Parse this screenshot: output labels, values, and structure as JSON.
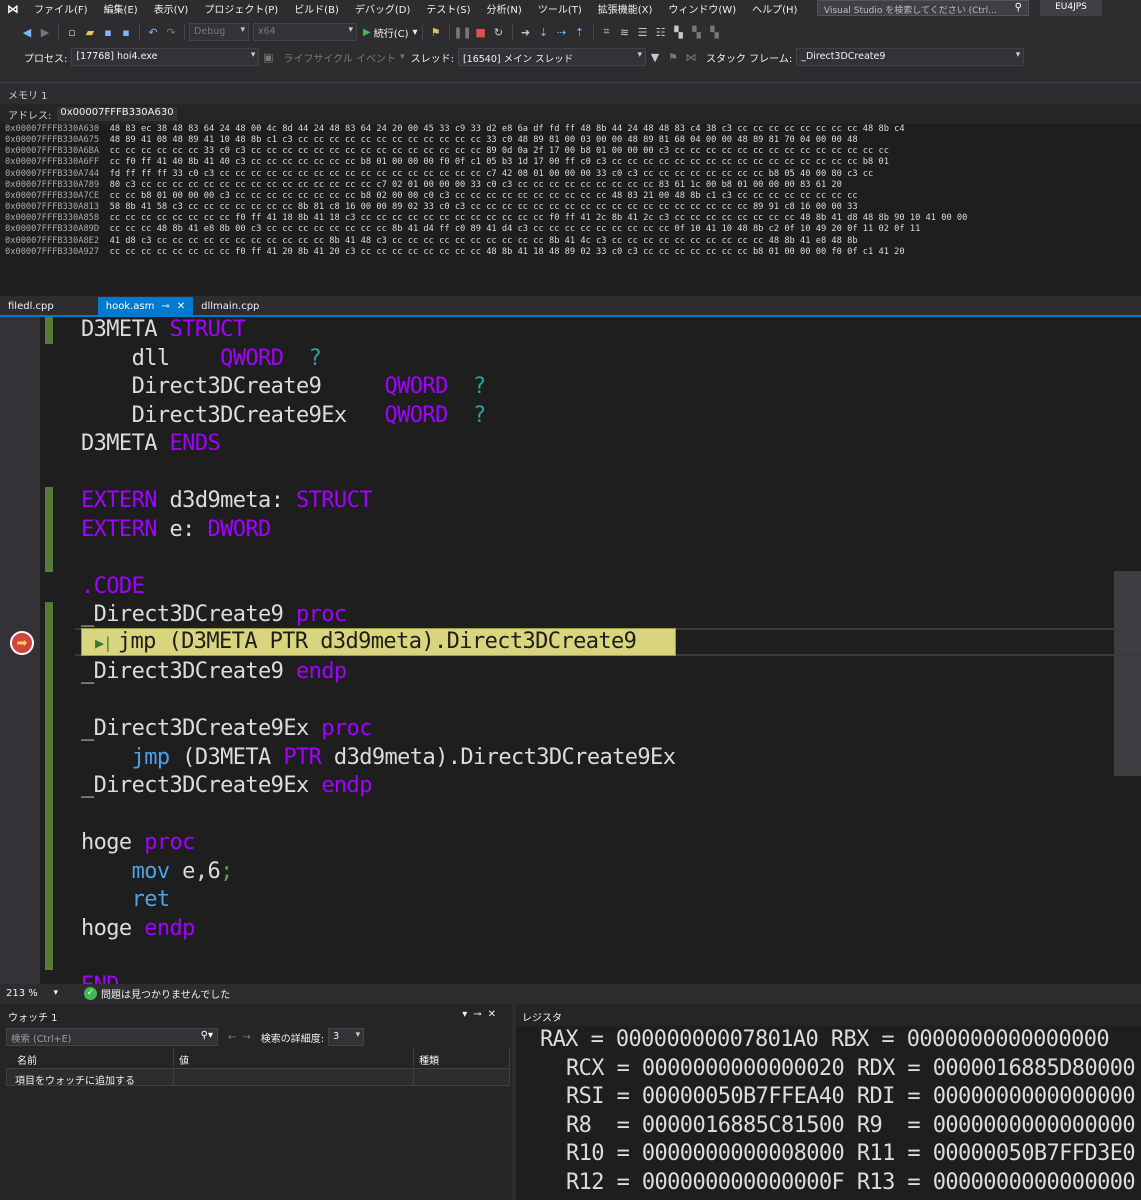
{
  "menu": {
    "items": [
      "ファイル(F)",
      "編集(E)",
      "表示(V)",
      "プロジェクト(P)",
      "ビルド(B)",
      "デバッグ(D)",
      "テスト(S)",
      "分析(N)",
      "ツール(T)",
      "拡張機能(X)",
      "ウィンドウ(W)",
      "ヘルプ(H)"
    ],
    "search_placeholder": "Visual Studio を検索してください (Ctrl...",
    "project_name": "EU4JPS"
  },
  "toolbar": {
    "config": "Debug",
    "platform": "x64",
    "continue_label": "続行(C)",
    "process_label": "プロセス:",
    "process_value": "[17768] hoi4.exe",
    "lifecycle_label": "ライフサイクル イベント",
    "thread_label": "スレッド:",
    "thread_value": "[16540] メイン スレッド",
    "stack_frame_label": "スタック フレーム:",
    "stack_frame_value": "_Direct3DCreate9"
  },
  "memory": {
    "title": "メモリ 1",
    "address_label": "アドレス:",
    "address_value": "0x00007FFFB330A630",
    "rows": [
      {
        "addr": "0x00007FFFB330A630",
        "bytes": "48 83 ec 38 48 83 64 24 48 00 4c 8d 44 24 48 83 64 24 20 00 45 33 c9 33 d2 e8 6a df fd ff 48 8b 44 24 48 48 83 c4 38 c3 cc cc cc cc cc cc cc cc 48 8b c4"
      },
      {
        "addr": "0x00007FFFB330A675",
        "bytes": "48 89 41 08 48 89 41 10 48 8b c1 c3 cc cc cc cc cc cc cc cc cc cc cc cc 33 c0 48 89 81 00 03 00 00 48 89 81 68 04 00 00 48 89 81 70 04 00 00 48"
      },
      {
        "addr": "0x00007FFFB330A6BA",
        "bytes": "cc cc cc cc cc cc 33 c0 c3 cc cc cc cc cc cc cc cc cc cc cc cc cc cc cc 89 0d 0a 2f 17 00 b8 01 00 00 00 c3 cc cc cc cc cc cc cc cc cc cc cc cc cc cc"
      },
      {
        "addr": "0x00007FFFB330A6FF",
        "bytes": "cc f0 ff 41 40 8b 41 40 c3 cc cc cc cc cc cc cc b8 01 00 00 00 f0 0f c1 05 b3 1d 17 00 ff c0 c3 cc cc cc cc cc cc cc cc cc cc cc cc cc cc cc cc b8 01"
      },
      {
        "addr": "0x00007FFFB330A744",
        "bytes": "fd ff ff ff 33 c0 c3 cc cc cc cc cc cc cc cc cc cc cc cc cc cc cc cc cc c7 42 08 01 00 00 00 33 c0 c3 cc cc cc cc cc cc cc cc b8 05 40 00 80 c3 cc"
      },
      {
        "addr": "0x00007FFFB330A789",
        "bytes": "80 c3 cc cc cc cc cc cc cc cc cc cc cc cc cc cc cc c7 02 01 00 00 00 33 c0 c3 cc cc cc cc cc cc cc cc cc 83 61 1c 00 b8 01 00 00 00 83 61 20"
      },
      {
        "addr": "0x00007FFFB330A7CE",
        "bytes": "cc cc b8 01 00 00 00 c3 cc cc cc cc cc cc cc cc b8 02 00 00 c0 c3 cc cc cc cc cc cc cc cc cc cc 48 83 21 00 48 8b c1 c3 cc cc cc cc cc cc cc cc"
      },
      {
        "addr": "0x00007FFFB330A813",
        "bytes": "58 8b 41 58 c3 cc cc cc cc cc cc cc 8b 81 c8 16 00 00 89 02 33 c0 c3 cc cc cc cc cc cc cc cc cc cc cc cc cc cc cc cc cc cc 89 91 c8 16 00 00 33"
      },
      {
        "addr": "0x00007FFFB330A858",
        "bytes": "cc cc cc cc cc cc cc cc f0 ff 41 18 8b 41 18 c3 cc cc cc cc cc cc cc cc cc cc cc cc f0 ff 41 2c 8b 41 2c c3 cc cc cc cc cc cc cc cc 48 8b 41 d8 48 8b 90 10 41 00 00"
      },
      {
        "addr": "0x00007FFFB330A89D",
        "bytes": "cc cc cc 48 8b 41 e8 8b 00 c3 cc cc cc cc cc cc cc cc 8b 41 d4 ff c0 89 41 d4 c3 cc cc cc cc cc cc cc cc cc 0f 10 41 10 48 8b c2 0f 10 49 20 0f 11 02 0f 11"
      },
      {
        "addr": "0x00007FFFB330A8E2",
        "bytes": "41 d8 c3 cc cc cc cc cc cc cc cc cc cc cc 8b 41 48 c3 cc cc cc cc cc cc cc cc cc cc 8b 41 4c c3 cc cc cc cc cc cc cc cc cc cc 48 8b 41 e8 48 8b"
      },
      {
        "addr": "0x00007FFFB330A927",
        "bytes": "cc cc cc cc cc cc cc cc f0 ff 41 20 8b 41 20 c3 cc cc cc cc cc cc cc cc 48 8b 41 18 48 89 02 33 c0 c3 cc cc cc cc cc cc cc b8 01 00 00 00 f0 0f c1 41 20"
      }
    ]
  },
  "tabs": [
    {
      "label": "filedl.cpp"
    },
    {
      "label": "hook.asm"
    },
    {
      "label": "dllmain.cpp"
    }
  ],
  "editor": {
    "current_statement": "jmp (D3META PTR d3d9meta).Direct3DCreate9",
    "lines": [
      [
        {
          "t": "D3META ",
          "c": "id"
        },
        {
          "t": "STRUCT",
          "c": "kw"
        }
      ],
      [
        {
          "t": "    dll    ",
          "c": "id"
        },
        {
          "t": "QWORD",
          "c": "kw"
        },
        {
          "t": "  ?",
          "c": "q"
        }
      ],
      [
        {
          "t": "    Direct3DCreate9     ",
          "c": "id"
        },
        {
          "t": "QWORD",
          "c": "kw"
        },
        {
          "t": "  ?",
          "c": "q"
        }
      ],
      [
        {
          "t": "    Direct3DCreate9Ex   ",
          "c": "id"
        },
        {
          "t": "QWORD",
          "c": "kw"
        },
        {
          "t": "  ?",
          "c": "q"
        }
      ],
      [
        {
          "t": "D3META ",
          "c": "id"
        },
        {
          "t": "ENDS",
          "c": "kw"
        }
      ],
      [],
      [
        {
          "t": "EXTERN ",
          "c": "kw"
        },
        {
          "t": "d3d9meta: ",
          "c": "id"
        },
        {
          "t": "STRUCT",
          "c": "kw"
        }
      ],
      [
        {
          "t": "EXTERN ",
          "c": "kw"
        },
        {
          "t": "e: ",
          "c": "id"
        },
        {
          "t": "DWORD",
          "c": "kw"
        }
      ],
      [],
      [
        {
          "t": ".CODE",
          "c": "kw"
        }
      ],
      [
        {
          "t": "_Direct3DCreate9 ",
          "c": "id"
        },
        {
          "t": "proc",
          "c": "kw"
        }
      ],
      [],
      [
        {
          "t": "_Direct3DCreate9 ",
          "c": "id"
        },
        {
          "t": "endp",
          "c": "kw"
        }
      ],
      [],
      [
        {
          "t": "_Direct3DCreate9Ex ",
          "c": "id"
        },
        {
          "t": "proc",
          "c": "kw"
        }
      ],
      [
        {
          "t": "    ",
          "c": "id"
        },
        {
          "t": "jmp",
          "c": "ins"
        },
        {
          "t": " (D3META ",
          "c": "id"
        },
        {
          "t": "PTR",
          "c": "kw"
        },
        {
          "t": " d3d9meta).Direct3DCreate9Ex",
          "c": "id"
        }
      ],
      [
        {
          "t": "_Direct3DCreate9Ex ",
          "c": "id"
        },
        {
          "t": "endp",
          "c": "kw"
        }
      ],
      [],
      [
        {
          "t": "hoge ",
          "c": "id"
        },
        {
          "t": "proc",
          "c": "kw"
        }
      ],
      [
        {
          "t": "    ",
          "c": "id"
        },
        {
          "t": "mov",
          "c": "ins"
        },
        {
          "t": " e,6",
          "c": "id"
        },
        {
          "t": ";",
          "c": "semi"
        }
      ],
      [
        {
          "t": "    ",
          "c": "id"
        },
        {
          "t": "ret",
          "c": "ins"
        }
      ],
      [
        {
          "t": "hoge ",
          "c": "id"
        },
        {
          "t": "endp",
          "c": "kw"
        }
      ],
      [],
      [
        {
          "t": "END",
          "c": "kw"
        }
      ]
    ]
  },
  "status": {
    "zoom": "213 %",
    "issues": "問題は見つかりませんでした"
  },
  "watch": {
    "title": "ウォッチ 1",
    "search_placeholder": "検索 (Ctrl+E)",
    "search_depth_label": "検索の詳細度:",
    "search_depth_value": "3",
    "columns": [
      "名前",
      "値",
      "種類"
    ],
    "add_item_label": "項目をウォッチに追加する"
  },
  "registers": {
    "title": "レジスタ",
    "lines": [
      {
        "indent": "",
        "text": "RAX = 00000000007801A0 RBX = 0000000000000000"
      },
      {
        "indent": "  ",
        "text": "RCX = 0000000000000020 RDX = 0000016885D80000"
      },
      {
        "indent": "  ",
        "text": "RSI = 00000050B7FFEA40 RDI = 0000000000000000"
      },
      {
        "indent": "  ",
        "text": "R8  = 0000016885C81500 R9  = 0000000000000000"
      },
      {
        "indent": "  ",
        "text": "R10 = 0000000000008000 R11 = 00000050B7FFD3E0"
      },
      {
        "indent": "  ",
        "text": "R12 = 000000000000000F R13 = 0000000000000000"
      }
    ]
  }
}
